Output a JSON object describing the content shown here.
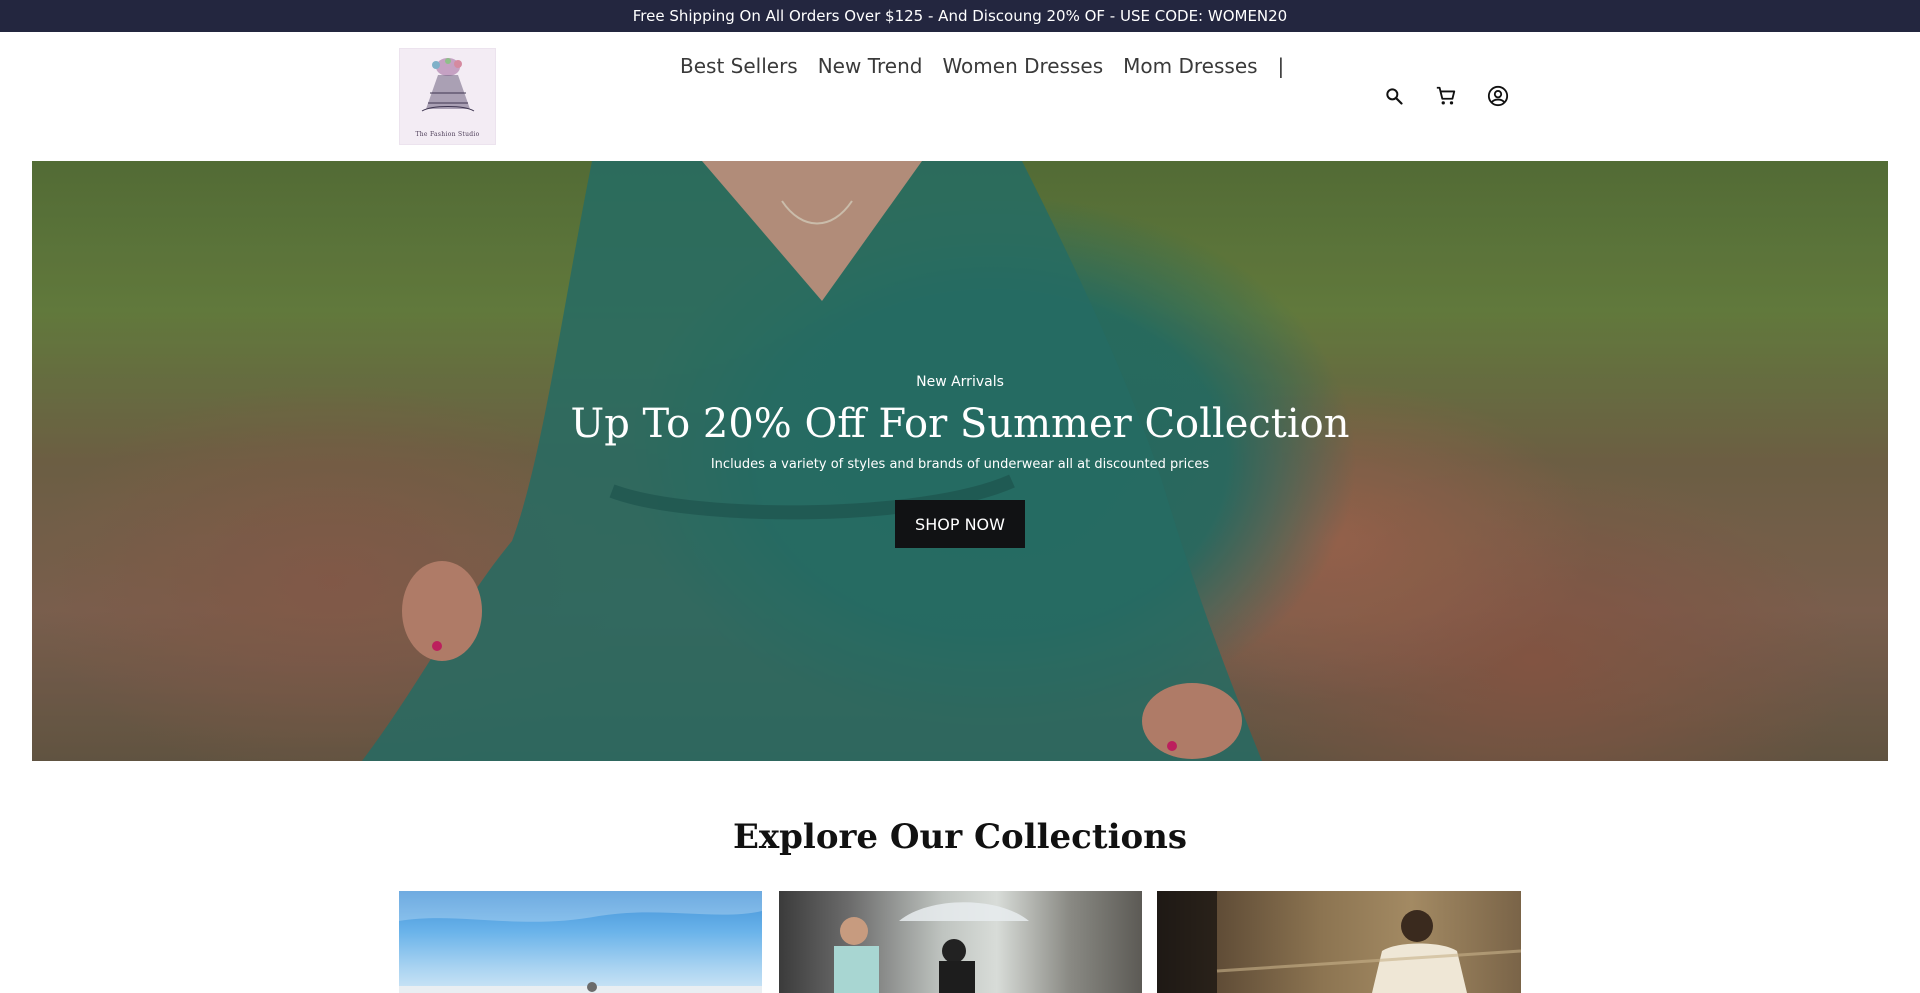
{
  "announcement": {
    "text": "Free Shipping On All Orders Over $125 - And Discoung 20% OF - USE CODE: WOMEN20"
  },
  "header": {
    "logo_text": "The Fashion Studio",
    "nav": [
      {
        "label": "Best Sellers"
      },
      {
        "label": "New Trend"
      },
      {
        "label": "Women Dresses"
      },
      {
        "label": "Mom Dresses"
      }
    ],
    "nav_separator": "|",
    "icons": [
      "search-icon",
      "cart-icon",
      "account-icon"
    ]
  },
  "hero": {
    "eyebrow": "New Arrivals",
    "title": "Up To 20% Off For Summer Collection",
    "subtitle": "Includes a variety of styles and brands of underwear all at discounted prices",
    "button_label": "SHOP NOW"
  },
  "collections": {
    "title": "Explore Our Collections",
    "cards": [
      {
        "image": "beach-sky-photo"
      },
      {
        "image": "couple-umbrella-photo"
      },
      {
        "image": "woman-staircase-photo"
      }
    ]
  },
  "colors": {
    "announcement_bg": "#23263f",
    "button_bg": "#111214",
    "dress_teal": "#2a7a70"
  }
}
